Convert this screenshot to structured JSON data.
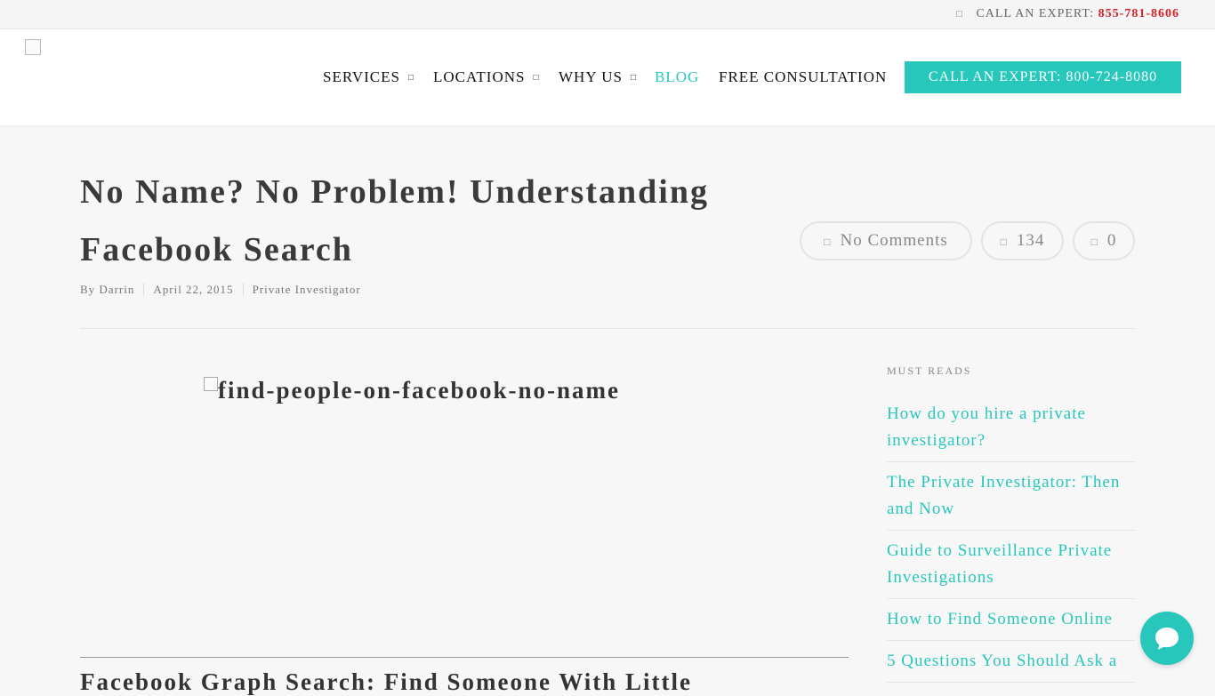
{
  "topbar": {
    "icon": "phone-icon",
    "expert_label": "CALL AN EXPERT: ",
    "expert_phone": "855-781-8606"
  },
  "nav": {
    "items": [
      {
        "label": "SERVICES",
        "has_dropdown": true
      },
      {
        "label": "LOCATIONS",
        "has_dropdown": true
      },
      {
        "label": "WHY US",
        "has_dropdown": true
      },
      {
        "label": "BLOG",
        "active": true
      },
      {
        "label": "FREE CONSULTATION"
      }
    ],
    "cta_label": "CALL AN EXPERT: 800-724-8080"
  },
  "post": {
    "title": "No Name? No Problem! Understanding Facebook Search",
    "author": "By Darrin",
    "date": "April 22, 2015",
    "category": "Private Investigator",
    "comments": "No Comments",
    "views": "134",
    "likes": "0",
    "image_alt": "find-people-on-facebook-no-name",
    "sub_heading": "Facebook Graph Search: Find Someone With Little"
  },
  "sidebar": {
    "label": "MUST READS",
    "items": [
      "How do you hire a private investigator?",
      "The Private Investigator: Then and Now",
      "Guide to Surveillance Private Investigations",
      "How to Find Someone Online",
      "5 Questions You Should Ask a"
    ]
  },
  "colors": {
    "accent": "#27c7bc",
    "phone": "#d92027",
    "background": "#f7f7f7"
  }
}
